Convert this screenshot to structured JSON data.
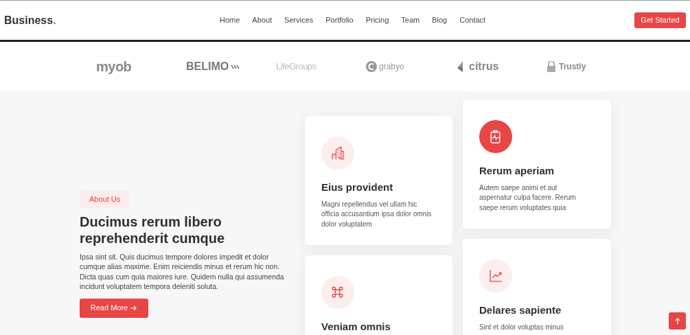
{
  "header": {
    "logo": "Business",
    "logo_dot": ".",
    "nav": [
      {
        "label": "Home",
        "selected": false
      },
      {
        "label": "About",
        "selected": false
      },
      {
        "label": "Services",
        "selected": false
      },
      {
        "label": "Portfolio",
        "selected": false
      },
      {
        "label": "Pricing",
        "selected": false
      },
      {
        "label": "Team",
        "selected": false
      },
      {
        "label": "Blog",
        "selected": false
      },
      {
        "label": "Contact",
        "selected": false
      }
    ],
    "cta": "Get Started"
  },
  "clients": [
    {
      "kind": "plain",
      "name": "myob"
    },
    {
      "kind": "stripes",
      "name": "BELIMO"
    },
    {
      "kind": "light",
      "name": "LifeGroups"
    },
    {
      "kind": "circle",
      "name": "grabyo"
    },
    {
      "kind": "shard",
      "name": "cítrus"
    },
    {
      "kind": "lock",
      "name": "Trustly"
    }
  ],
  "about": {
    "badge": "About Us",
    "title": "Ducimus rerum libero reprehenderit cumque",
    "text": "Ipsa sint sit. Quis ducimus tempore dolores impedit et dolor cumque alias maxime. Enim reiciendis minus et rerum hic non. Dicta quas cum quia maiores iure. Quidem nulla qui assumenda incidunt voluptatem tempora deleniti soluta.",
    "button": "Read More"
  },
  "cards": [
    {
      "kind": "building",
      "highlighted": false,
      "title": "Eius provident",
      "text": "Magni repellendus vel ullam hic officia accusantium ipsa dolor omnis dolor voluptatem"
    },
    {
      "kind": "clipboard",
      "highlighted": true,
      "title": "Rerum aperiam",
      "text": "Autem saepe animi et aut aspernatur culpa facere. Rerum saepe rerum voluptates quia"
    },
    {
      "kind": "command",
      "highlighted": false,
      "title": "Veniam omnis"
    },
    {
      "kind": "chart",
      "highlighted": false,
      "title": "Delares sapiente",
      "text": "Sint et dolor voluptas minus"
    }
  ]
}
